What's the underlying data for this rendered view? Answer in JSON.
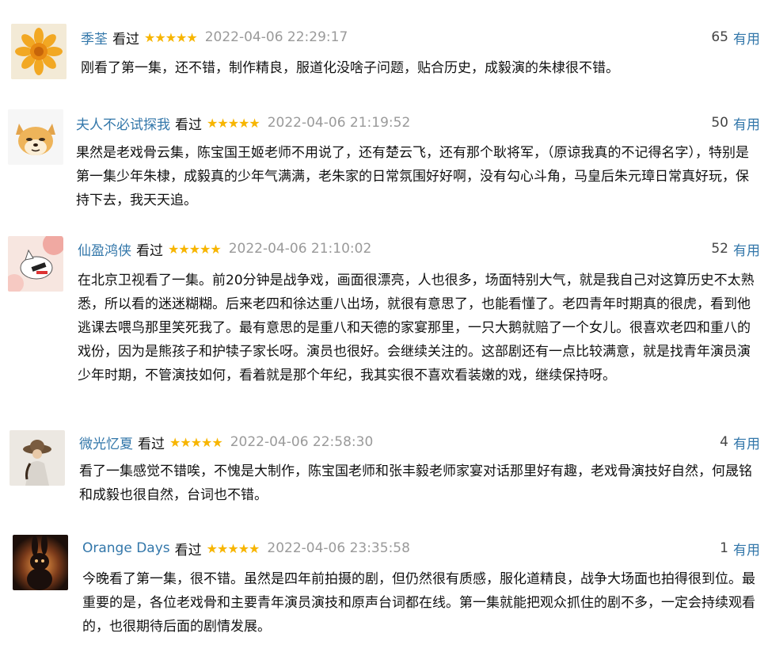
{
  "comments": [
    {
      "user": "季荃",
      "status": "看过",
      "stars": "★★★★★",
      "time": "2022-04-06 22:29:17",
      "votes": "65",
      "useful_label": "有用",
      "avatar": "sunflower",
      "text": "刚看了第一集，还不错，制作精良，服道化没啥子问题，贴合历史，成毅演的朱棣很不错。"
    },
    {
      "user": "夫人不必试探我",
      "status": "看过",
      "stars": "★★★★★",
      "time": "2022-04-06 21:19:52",
      "votes": "50",
      "useful_label": "有用",
      "avatar": "shiba-dog",
      "text": "果然是老戏骨云集，陈宝国王姬老师不用说了，还有楚云飞，还有那个耿将军，（原谅我真的不记得名字），特别是第一集少年朱棣，成毅真的少年气满满，老朱家的日常氛围好好啊，没有勾心斗角，马皇后朱元璋日常真好玩，保持下去，我天天追。"
    },
    {
      "user": "仙盈鸿侠",
      "status": "看过",
      "stars": "★★★★★",
      "time": "2022-04-06 21:10:02",
      "votes": "52",
      "useful_label": "有用",
      "avatar": "cat-illustration",
      "text": "在北京卫视看了一集。前20分钟是战争戏，画面很漂亮，人也很多，场面特别大气，就是我自己对这算历史不太熟悉，所以看的迷迷糊糊。后来老四和徐达重八出场，就很有意思了，也能看懂了。老四青年时期真的很虎，看到他逃课去喂鸟那里笑死我了。最有意思的是重八和天德的家宴那里，一只大鹅就赔了一个女儿。很喜欢老四和重八的戏份，因为是熊孩子和护犊子家长呀。演员也很好。会继续关注的。这部剧还有一点比较满意，就是找青年演员演少年时期，不管演技如何，看着就是那个年纪，我其实很不喜欢看装嫩的戏，继续保持呀。"
    },
    {
      "user": "微光忆夏",
      "status": "看过",
      "stars": "★★★★★",
      "time": "2022-04-06 22:58:30",
      "votes": "4",
      "useful_label": "有用",
      "avatar": "girl-hat-photo",
      "text": "看了一集感觉不错唉，不愧是大制作，陈宝国老师和张丰毅老师家宴对话那里好有趣，老戏骨演技好自然，何晟铭和成毅也很自然，台词也不错。"
    },
    {
      "user": "Orange Days",
      "status": "看过",
      "stars": "★★★★★",
      "time": "2022-04-06 23:35:58",
      "votes": "1",
      "useful_label": "有用",
      "avatar": "rabbit-silhouette",
      "text": "今晚看了第一集，很不错。虽然是四年前拍摄的剧，但仍然很有质感，服化道精良，战争大场面也拍得很到位。最重要的是，各位老戏骨和主要青年演员演技和原声台词都在线。第一集就能把观众抓住的剧不多，一定会持续观看的，也很期待后面的剧情发展。"
    }
  ]
}
